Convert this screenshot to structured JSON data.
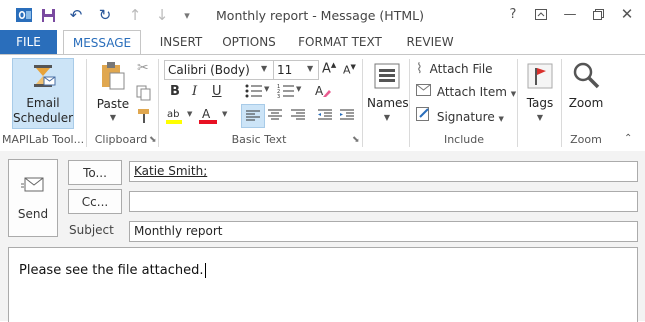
{
  "window": {
    "title": "Monthly report - Message (HTML)",
    "help": "?"
  },
  "tabs": [
    "FILE",
    "MESSAGE",
    "INSERT",
    "OPTIONS",
    "FORMAT TEXT",
    "REVIEW"
  ],
  "ribbon": {
    "mapilab": {
      "button_line1": "Email",
      "button_line2": "Scheduler",
      "group": "MAPILab Tool..."
    },
    "clipboard": {
      "paste": "Paste",
      "group": "Clipboard"
    },
    "basic_text": {
      "font": "Calibri (Body)",
      "size": "11",
      "bold": "B",
      "italic": "I",
      "underline": "U",
      "group": "Basic Text"
    },
    "names": {
      "label": "Names"
    },
    "include": {
      "attach_file": "Attach File",
      "attach_item": "Attach Item",
      "signature": "Signature",
      "group": "Include"
    },
    "tags": {
      "label": "Tags"
    },
    "zoom": {
      "label": "Zoom",
      "group": "Zoom"
    }
  },
  "compose": {
    "send": "Send",
    "to_button": "To...",
    "cc_button": "Cc...",
    "subject_label": "Subject",
    "to_value": "Katie Smith;",
    "cc_value": "",
    "subject_value": "Monthly report",
    "body_text": "Please see the file attached."
  },
  "colors": {
    "accent": "#2a6ebb",
    "highlight": "#ffff00",
    "font_color": "#e81123",
    "selected": "#cce4f7"
  }
}
